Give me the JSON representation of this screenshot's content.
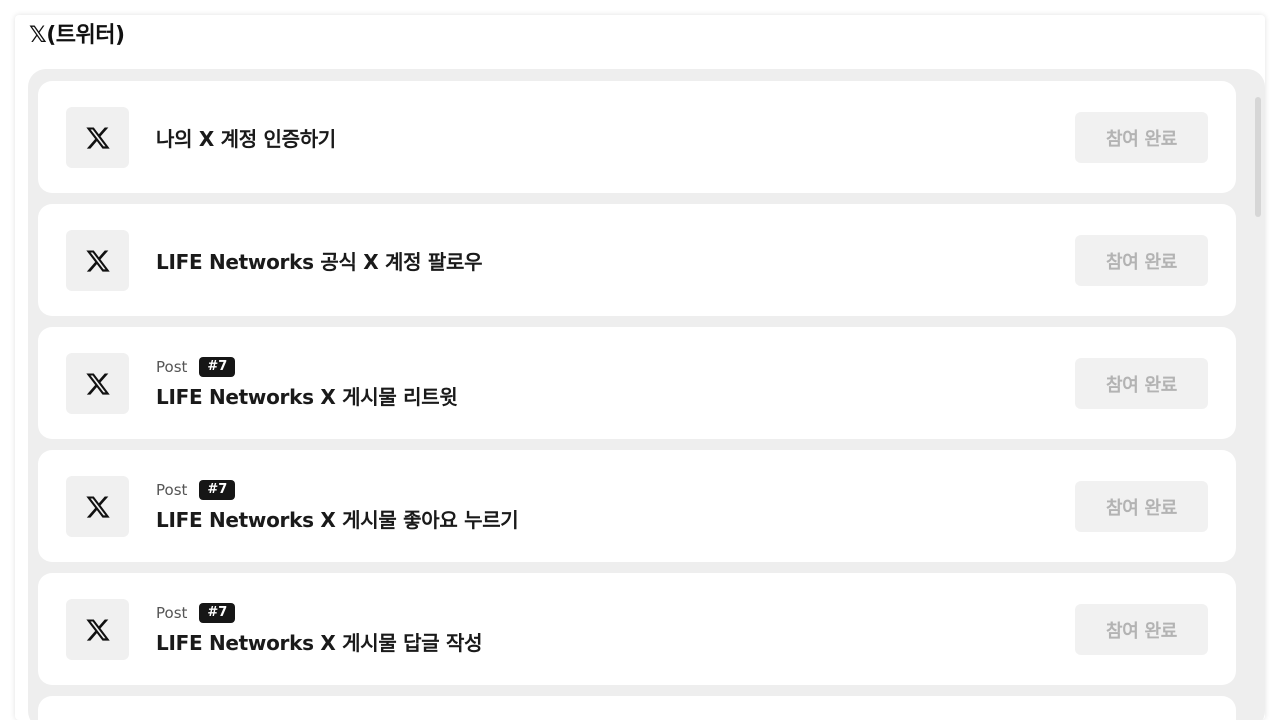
{
  "section": {
    "title": "(트위터)",
    "icon": "x-logo-icon"
  },
  "items": [
    {
      "title": "나의 X 계정 인증하기",
      "meta_label": null,
      "badge": null,
      "button_label": "참여 완료"
    },
    {
      "title": "LIFE Networks 공식 X 계정 팔로우",
      "meta_label": null,
      "badge": null,
      "button_label": "참여 완료"
    },
    {
      "title": "LIFE Networks X 게시물 리트윗",
      "meta_label": "Post",
      "badge": "#7",
      "button_label": "참여 완료"
    },
    {
      "title": "LIFE Networks X 게시물 좋아요 누르기",
      "meta_label": "Post",
      "badge": "#7",
      "button_label": "참여 완료"
    },
    {
      "title": "LIFE Networks X 게시물 답글 작성",
      "meta_label": "Post",
      "badge": "#7",
      "button_label": "참여 완료"
    }
  ],
  "colors": {
    "list_background": "#eeeeee",
    "card_background": "#ffffff",
    "icon_tile": "#f0f0f0",
    "badge_background": "#161616",
    "button_disabled_text": "#b3b3b3"
  }
}
